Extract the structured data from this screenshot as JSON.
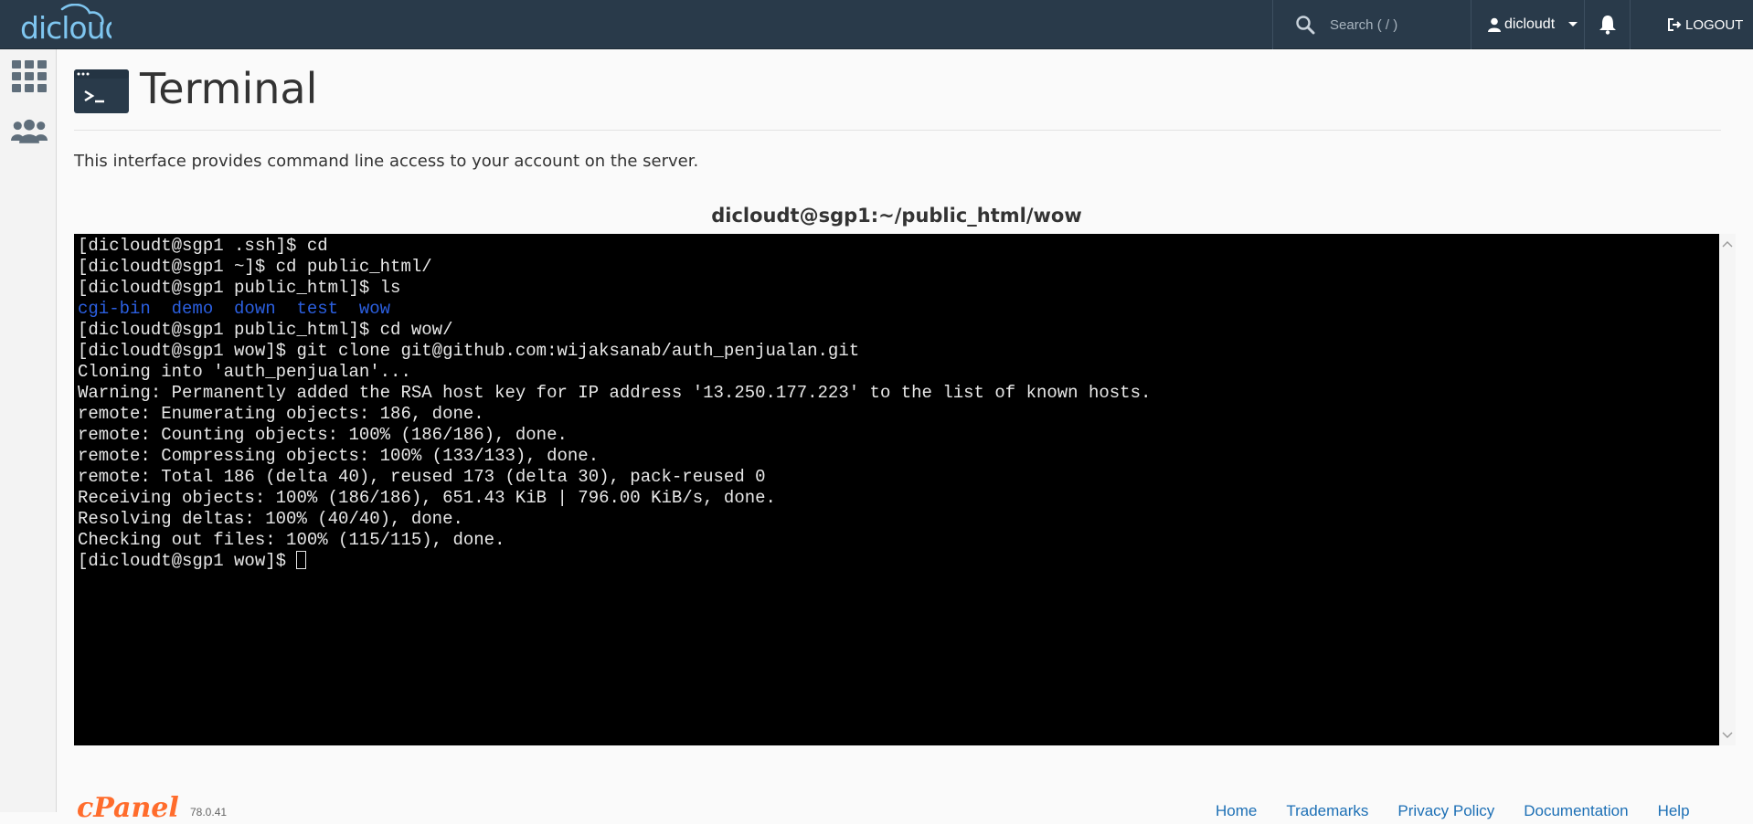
{
  "app": {
    "logo_text": "dicloud",
    "colors": {
      "topbar": "#293a4a",
      "logo": "#7fc6f0",
      "terminal_bg": "#000000",
      "terminal_fg": "#e8e8e8",
      "dir_blue": "#2b5fe0",
      "cpanel_orange": "#ff6c2c",
      "link": "#1c6fb5"
    }
  },
  "header": {
    "search_placeholder": "Search ( / )",
    "search_icon": "search-icon",
    "username": "dicloudt",
    "user_icon": "user-icon",
    "notifications_icon": "bell-icon",
    "logout_label": "LOGOUT",
    "logout_icon": "logout-icon"
  },
  "sidebar": {
    "items": [
      {
        "icon": "grid-icon"
      },
      {
        "icon": "users-icon"
      }
    ]
  },
  "page": {
    "title": "Terminal",
    "icon": "terminal-icon",
    "description": "This interface provides command line access to your account on the server."
  },
  "terminal": {
    "title": "dicloudt@sgp1:~/public_html/wow",
    "lines": [
      {
        "text": "[dicloudt@sgp1 .ssh]$ cd",
        "style": "normal"
      },
      {
        "text": "[dicloudt@sgp1 ~]$ cd public_html/",
        "style": "normal"
      },
      {
        "text": "[dicloudt@sgp1 public_html]$ ls",
        "style": "normal"
      },
      {
        "text": "cgi-bin  demo  down  test  wow",
        "style": "blue"
      },
      {
        "text": "[dicloudt@sgp1 public_html]$ cd wow/",
        "style": "normal"
      },
      {
        "text": "[dicloudt@sgp1 wow]$ git clone git@github.com:wijaksanab/auth_penjualan.git",
        "style": "normal"
      },
      {
        "text": "Cloning into 'auth_penjualan'...",
        "style": "normal"
      },
      {
        "text": "Warning: Permanently added the RSA host key for IP address '13.250.177.223' to the list of known hosts.",
        "style": "normal"
      },
      {
        "text": "remote: Enumerating objects: 186, done.",
        "style": "normal"
      },
      {
        "text": "remote: Counting objects: 100% (186/186), done.",
        "style": "normal"
      },
      {
        "text": "remote: Compressing objects: 100% (133/133), done.",
        "style": "normal"
      },
      {
        "text": "remote: Total 186 (delta 40), reused 173 (delta 30), pack-reused 0",
        "style": "normal"
      },
      {
        "text": "Receiving objects: 100% (186/186), 651.43 KiB | 796.00 KiB/s, done.",
        "style": "normal"
      },
      {
        "text": "Resolving deltas: 100% (40/40), done.",
        "style": "normal"
      },
      {
        "text": "Checking out files: 100% (115/115), done.",
        "style": "normal"
      }
    ],
    "prompt": "[dicloudt@sgp1 wow]$ "
  },
  "footer": {
    "brand": "cPanel",
    "version": "78.0.41",
    "links": [
      "Home",
      "Trademarks",
      "Privacy Policy",
      "Documentation",
      "Help"
    ]
  }
}
